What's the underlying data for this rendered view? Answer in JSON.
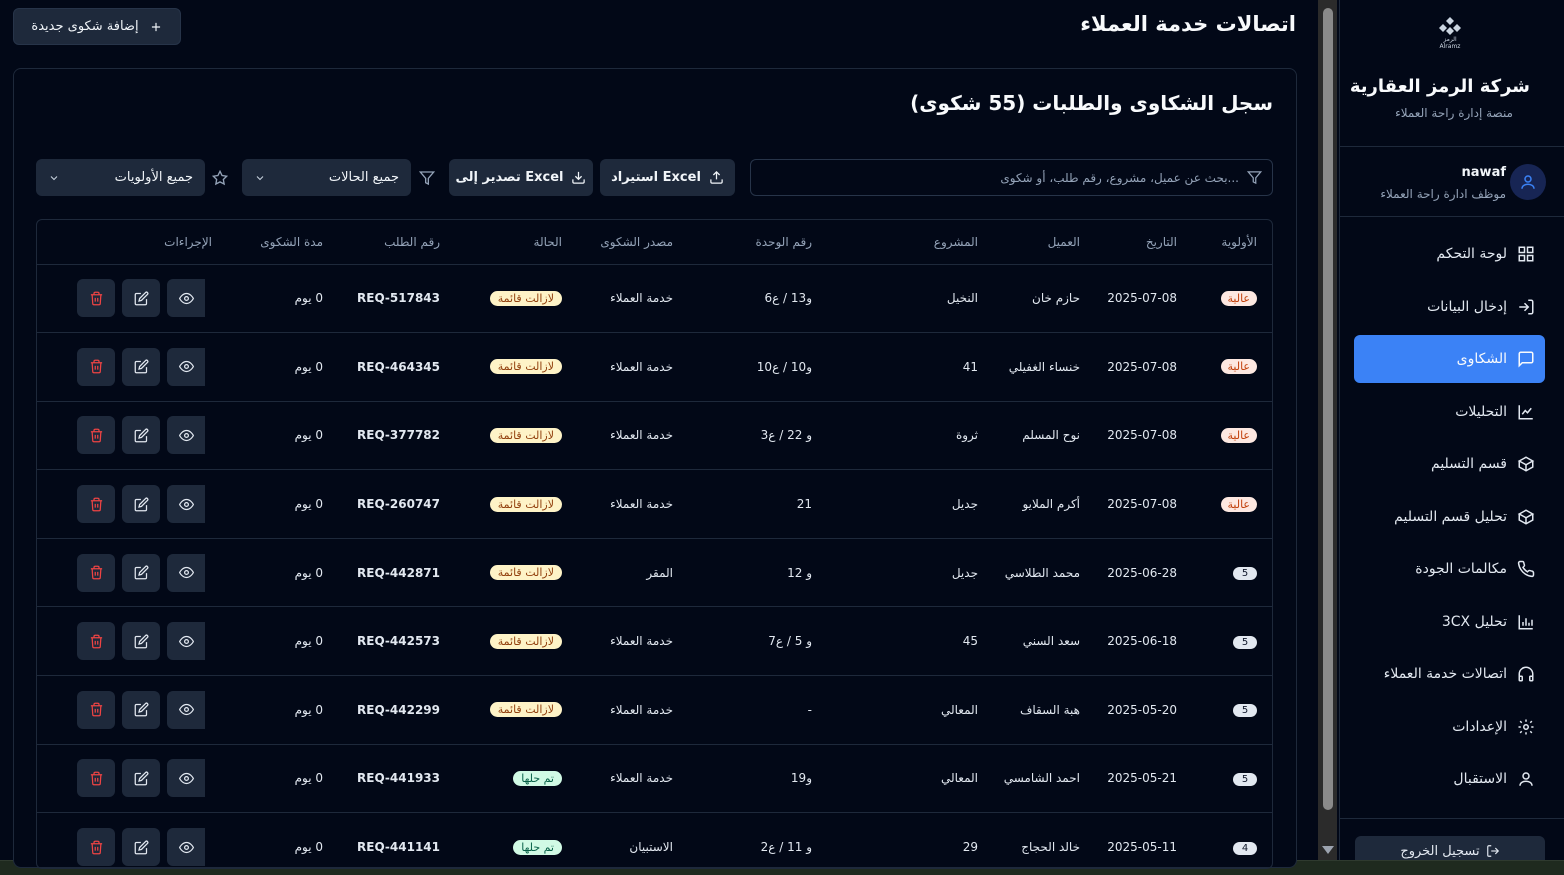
{
  "brand": {
    "logo_text": "الرمز",
    "logo_sub": "Alramz",
    "name": "شركة الرمز العقارية",
    "subtitle": "منصة إدارة راحة العملاء"
  },
  "user": {
    "name": "nawaf",
    "role": "موظف ادارة راحة العملاء"
  },
  "nav": [
    {
      "label": "لوحة التحكم",
      "icon": "dashboard-icon",
      "active": false
    },
    {
      "label": "إدخال البيانات",
      "icon": "login-icon",
      "active": false
    },
    {
      "label": "الشكاوى",
      "icon": "message-icon",
      "active": true
    },
    {
      "label": "التحليلات",
      "icon": "line-chart-icon",
      "active": false
    },
    {
      "label": "قسم التسليم",
      "icon": "box-icon",
      "active": false
    },
    {
      "label": "تحليل قسم التسليم",
      "icon": "box-icon",
      "active": false
    },
    {
      "label": "مكالمات الجودة",
      "icon": "phone-icon",
      "active": false
    },
    {
      "label": "تحليل 3CX",
      "icon": "bar-chart-icon",
      "active": false
    },
    {
      "label": "اتصالات خدمة العملاء",
      "icon": "headphones-icon",
      "active": false
    },
    {
      "label": "الإعدادات",
      "icon": "gear-icon",
      "active": false
    },
    {
      "label": "الاستقبال",
      "icon": "user-icon",
      "active": false
    }
  ],
  "logout_label": "تسجيل الخروج",
  "page_title": "اتصالات خدمة العملاء",
  "add_button": "إضافة شكوى جديدة",
  "card_title": "سجل الشكاوى والطلبات (55 شكوى)",
  "search_placeholder": "بحث عن عميل، مشروع، رقم طلب، أو شكوى...",
  "import_button": "استيراد Excel",
  "export_button": "تصدير إلى Excel",
  "status_filter": "جميع الحالات",
  "priority_filter": "جميع الأولويات",
  "columns": [
    "الأولوية",
    "التاريخ",
    "العميل",
    "المشروع",
    "رقم الوحدة",
    "مصدر الشكوى",
    "الحالة",
    "رقم الطلب",
    "مدة الشكوى",
    "الإجراءات"
  ],
  "rows": [
    {
      "priority": "عالية",
      "date": "2025-07-08",
      "client": "حازم خان",
      "project": "النخيل",
      "unit": "و13 / ع6",
      "source": "خدمة العملاء",
      "status": "لازالت قائمة",
      "req": "REQ-517843",
      "duration": "0 يوم"
    },
    {
      "priority": "عالية",
      "date": "2025-07-08",
      "client": "خنساء الغفيلي",
      "project": "41",
      "unit": "و10 / ع10",
      "source": "خدمة العملاء",
      "status": "لازالت قائمة",
      "req": "REQ-464345",
      "duration": "0 يوم"
    },
    {
      "priority": "عالية",
      "date": "2025-07-08",
      "client": "نوح المسلم",
      "project": "ثروة",
      "unit": "و 22 / ع3",
      "source": "خدمة العملاء",
      "status": "لازالت قائمة",
      "req": "REQ-377782",
      "duration": "0 يوم"
    },
    {
      "priority": "عالية",
      "date": "2025-07-08",
      "client": "أكرم الملايو",
      "project": "جديل",
      "unit": "21",
      "source": "خدمة العملاء",
      "status": "لازالت قائمة",
      "req": "REQ-260747",
      "duration": "0 يوم"
    },
    {
      "priority": "5",
      "date": "2025-06-28",
      "client": "محمد الطلاسي",
      "project": "جديل",
      "unit": "و 12",
      "source": "المقر",
      "status": "لازالت قائمة",
      "req": "REQ-442871",
      "duration": "0 يوم"
    },
    {
      "priority": "5",
      "date": "2025-06-18",
      "client": "سعد السني",
      "project": "45",
      "unit": "و 5 / ع7",
      "source": "خدمة العملاء",
      "status": "لازالت قائمة",
      "req": "REQ-442573",
      "duration": "0 يوم"
    },
    {
      "priority": "5",
      "date": "2025-05-20",
      "client": "هبة السقاف",
      "project": "المعالي",
      "unit": "-",
      "source": "خدمة العملاء",
      "status": "لازالت قائمة",
      "req": "REQ-442299",
      "duration": "0 يوم"
    },
    {
      "priority": "5",
      "date": "2025-05-21",
      "client": "احمد الشامسي",
      "project": "المعالي",
      "unit": "و19",
      "source": "خدمة العملاء",
      "status": "تم حلها",
      "req": "REQ-441933",
      "duration": "0 يوم"
    },
    {
      "priority": "4",
      "date": "2025-05-11",
      "client": "خالد الحجاج",
      "project": "29",
      "unit": "و 11 / ع2",
      "source": "الاستبيان",
      "status": "تم حلها",
      "req": "REQ-441141",
      "duration": "0 يوم"
    }
  ],
  "colors": {
    "background": "#020817",
    "accent": "#3b82f6",
    "panel": "#1e293b",
    "danger": "#ef4444"
  }
}
